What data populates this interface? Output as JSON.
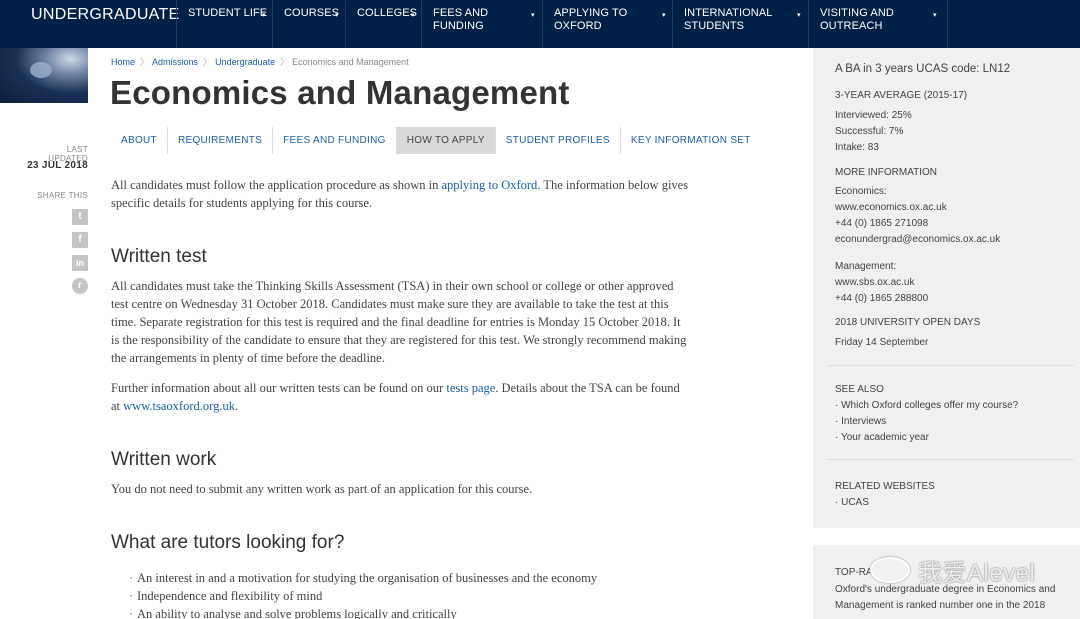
{
  "nav": {
    "brand": "UNDERGRADUATE",
    "items": [
      {
        "label": "STUDENT LIFE"
      },
      {
        "label": "COURSES"
      },
      {
        "label": "COLLEGES"
      },
      {
        "label": "FEES AND FUNDING"
      },
      {
        "label": "APPLYING TO OXFORD"
      },
      {
        "label_line1": "INTERNATIONAL",
        "label_line2": "STUDENTS"
      },
      {
        "label_line1": "VISITING AND",
        "label_line2": "OUTREACH"
      }
    ],
    "caret": "▾"
  },
  "left": {
    "last_updated_label": "LAST UPDATED",
    "last_updated_date": "23 JUL 2018",
    "share_label": "SHARE THIS",
    "share_icons": [
      "t",
      "f",
      "in",
      "r"
    ]
  },
  "breadcrumb": {
    "items": [
      "Home",
      "Admissions",
      "Undergraduate"
    ],
    "current": "Economics and Management",
    "sep": "〉"
  },
  "title": "Economics and Management",
  "tabs": [
    {
      "label": "ABOUT"
    },
    {
      "label": "REQUIREMENTS"
    },
    {
      "label": "FEES AND FUNDING"
    },
    {
      "label": "HOW TO APPLY"
    },
    {
      "label": "STUDENT PROFILES"
    },
    {
      "label": "KEY INFORMATION SET"
    }
  ],
  "content": {
    "intro_a": "All candidates must follow the application procedure as shown in ",
    "intro_link": "applying to Oxford",
    "intro_b": ". The information below gives specific details for students applying for this course.",
    "written_test_heading": "Written test",
    "written_test_p1": "All candidates must take the Thinking Skills Assessment (TSA) in their own school or college or other approved test centre on Wednesday 31 October 2018. Candidates must make sure they are available to take the test at this time. Separate registration for this test is required and the final deadline for entries is Monday 15 October 2018. It is the responsibility of the candidate to ensure that they are registered for this test. We strongly recommend making the arrangements in plenty of time before the deadline.",
    "written_test_p2_a": "Further information about all our written tests can be found on our ",
    "written_test_p2_link": "tests page",
    "written_test_p2_b": ". Details about the TSA can be found at ",
    "written_test_p2_link2": "www.tsaoxford.org.uk",
    "written_test_p2_c": ".",
    "written_work_heading": "Written work",
    "written_work_p": "You do not need to submit any written work as part of an application for this course.",
    "tutors_heading": "What are tutors looking for?",
    "tutors_list": [
      "An interest in and a motivation for studying the organisation of businesses and the economy",
      "Independence and flexibility of mind",
      "An ability to analyse and solve problems logically and critically"
    ]
  },
  "sidebar": {
    "degree": "A BA in 3 years UCAS code: LN12",
    "avg_heading": "3-YEAR AVERAGE (2015-17)",
    "interviewed": "Interviewed: 25%",
    "successful": "Successful: 7%",
    "intake": "Intake: 83",
    "more_info_heading": "MORE INFORMATION",
    "economics_label": "Economics:",
    "economics_web": "www.economics.ox.ac.uk",
    "economics_phone": "+44 (0) 1865 271098",
    "economics_email": "econundergrad@economics.ox.ac.uk",
    "management_label": "Management:",
    "management_web": "www.sbs.ox.ac.uk",
    "management_phone": "+44 (0) 1865 288800",
    "open_days_heading": "2018 UNIVERSITY OPEN DAYS",
    "open_days_date": "Friday 14 September",
    "see_also_heading": "SEE ALSO",
    "see_also": [
      "Which Oxford colleges offer my course?",
      "Interviews",
      "Your academic year"
    ],
    "related_heading": "RELATED WEBSITES",
    "related": [
      "UCAS"
    ],
    "top_heading": "TOP-RA",
    "top_text_1": "Oxford's undergraduate degree in Economics and",
    "top_text_2": "Management is ranked number one in the 2018"
  },
  "watermark": "我爱Alevel",
  "colors": {
    "nav_bg": "#002147",
    "link": "#1b5fa8",
    "sidebar_bg": "#f0f0f0"
  }
}
